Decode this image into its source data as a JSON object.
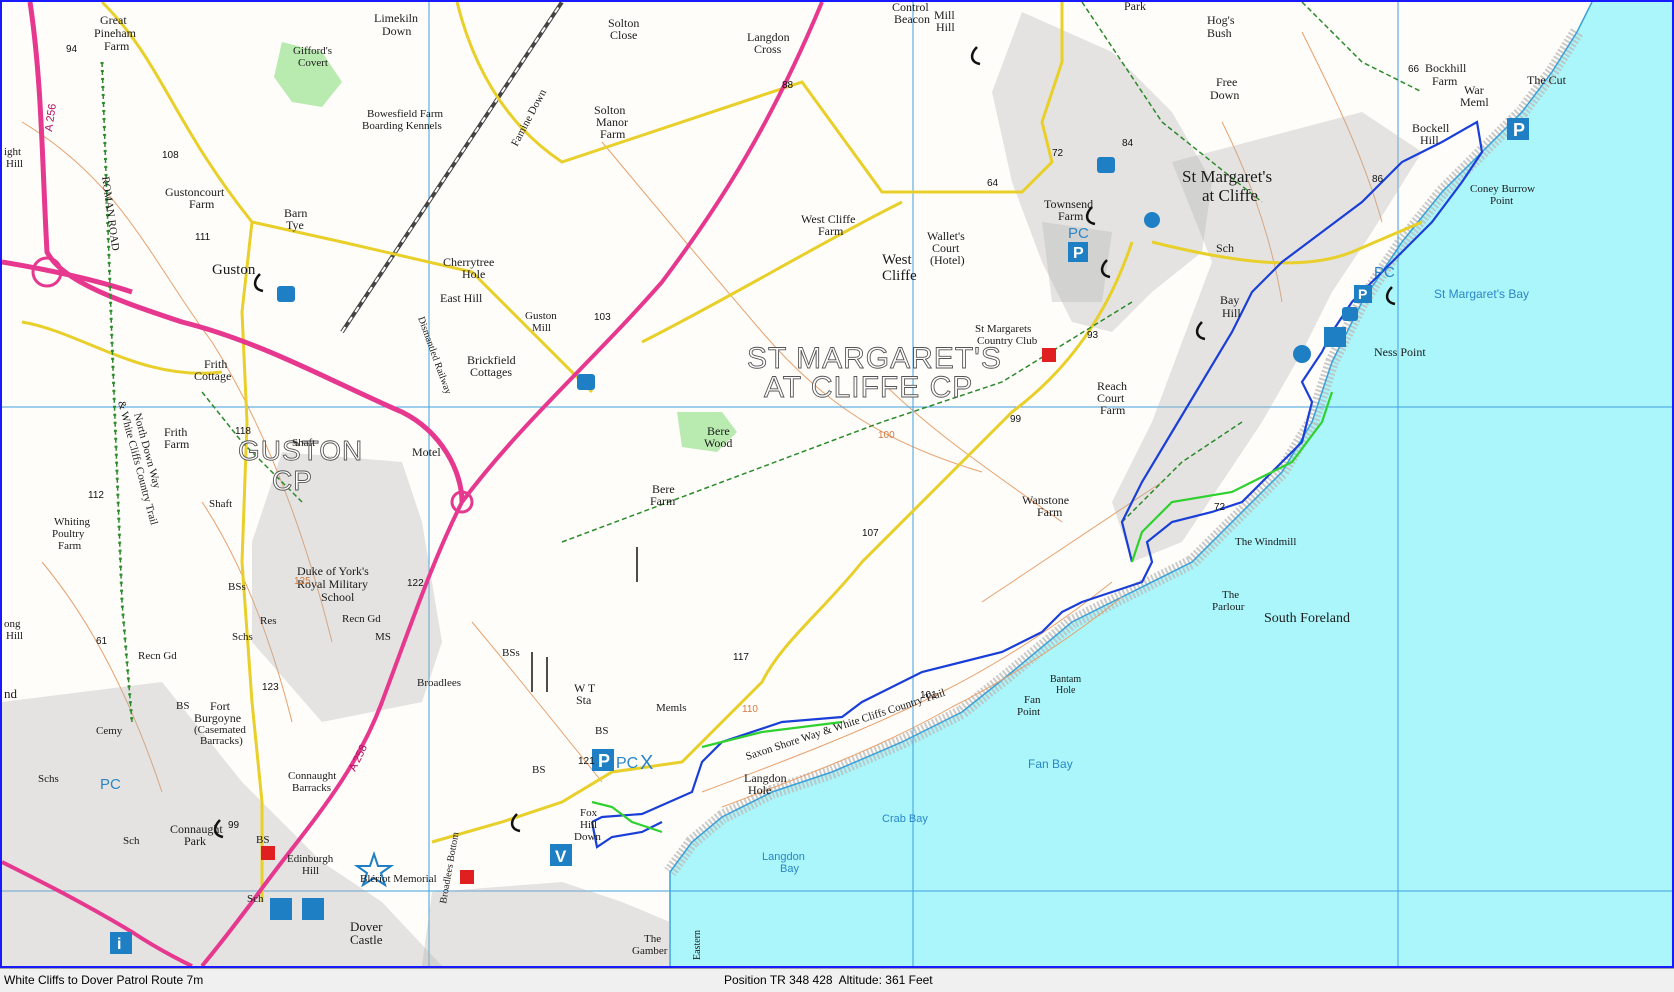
{
  "window": {
    "title": "White Cliffs to Dover Patrol Route 7m"
  },
  "status_bar": {
    "route_name": "White Cliffs to Dover Patrol Route 7m",
    "position_label": "Position",
    "position_value": "TR 348 428",
    "altitude_label": "Altitude:",
    "altitude_value": "361 Feet"
  },
  "map": {
    "colors": {
      "sea": "#aaf6fb",
      "land": "#fffdfa",
      "grid": "#3fa0e0",
      "route": "#1a3fd8",
      "route_green": "#2fd12f",
      "a_road": "#e6388e",
      "b_road": "#e8cf2a",
      "contour": "#e7a06c",
      "footpath": "#2b8a2b",
      "settlement": "#b2b2b2",
      "woodland": "#b9eab0",
      "poi_blue": "#1f7fc4",
      "poi_red": "#e02020"
    },
    "area_labels": {
      "st_margarets_cp_line1": "ST MARGARET'S",
      "st_margarets_cp_line2": "AT CLIFFE CP",
      "guston_cp_line1": "GUSTON",
      "guston_cp_line2": "CP"
    },
    "place_labels": {
      "great_pineham_1": "Great",
      "great_pineham_2": "Pineham",
      "great_pineham_3": "Farm",
      "limekiln_1": "Limekiln",
      "limekiln_2": "Down",
      "giffords_1": "Gifford's",
      "giffords_2": "Covert",
      "solton_close_1": "Solton",
      "solton_close_2": "Close",
      "langdon_cross_1": "Langdon",
      "langdon_cross_2": "Cross",
      "control_1": "Control",
      "control_2": "Beacon",
      "mill_hill_1": "Mill",
      "mill_hill_2": "Hill",
      "park": "Park",
      "hogs_bush_1": "Hog's",
      "hogs_bush_2": "Bush",
      "bockhill_1": "Bockhill",
      "bockhill_2": "Farm",
      "war_meml_1": "War",
      "war_meml_2": "Meml",
      "the_cut": "The Cut",
      "free_down_1": "Free",
      "free_down_2": "Down",
      "bowesfield_1": "Bowesfield Farm",
      "bowesfield_2": "Boarding Kennels",
      "famine_down": "Famine Down",
      "solton_manor_1": "Solton",
      "solton_manor_2": "Manor",
      "solton_manor_3": "Farm",
      "st_margarets_1": "St Margaret's",
      "st_margarets_2": "at Cliffe",
      "bockell_hill_1": "Bockell",
      "bockell_hill_2": "Hill",
      "coney_burrow_1": "Coney Burrow",
      "coney_burrow_2": "Point",
      "gustoncourt_1": "Gustoncourt",
      "gustoncourt_2": "Farm",
      "barn_tye_1": "Barn",
      "barn_tye_2": "Tye",
      "guston": "Guston",
      "west_cliffe_farm_1": "West Cliffe",
      "west_cliffe_farm_2": "Farm",
      "wallets_1": "Wallet's",
      "wallets_2": "Court",
      "wallets_3": "(Hotel)",
      "west_cliffe_1": "West",
      "west_cliffe_2": "Cliffe",
      "townsend_1": "Townsend",
      "townsend_2": "Farm",
      "sch": "Sch",
      "cherrytree_1": "Cherrytree",
      "cherrytree_2": "Hole",
      "east_hill": "East Hill",
      "guston_mill_1": "Guston",
      "guston_mill_2": "Mill",
      "brickfield_1": "Brickfield",
      "brickfield_2": "Cottages",
      "dismantled_railway": "Dismantled Railway",
      "bay_hill_1": "Bay",
      "bay_hill_2": "Hill",
      "st_margarets_bay": "St Margaret's Bay",
      "st_margarets_cc_1": "St Margarets",
      "st_margarets_cc_2": "Country Club",
      "ness_point": "Ness Point",
      "frith_cottage_1": "Frith",
      "frith_cottage_2": "Cottage",
      "reach_court_1": "Reach",
      "reach_court_2": "Court",
      "reach_court_3": "Farm",
      "frith_farm_1": "Frith",
      "frith_farm_2": "Farm",
      "shaft": "Shaft",
      "motel": "Motel",
      "bere_wood_1": "Bere",
      "bere_wood_2": "Wood",
      "bere_farm_1": "Bere",
      "bere_farm_2": "Farm",
      "whiting_1": "Whiting",
      "whiting_2": "Poultry",
      "whiting_3": "Farm",
      "wanstone_1": "Wanstone",
      "wanstone_2": "Farm",
      "the_windmill": "The Windmill",
      "duke_1": "Duke of York's",
      "duke_2": "Royal Military",
      "duke_3": "School",
      "north_downs_way": "North Down Way",
      "white_cliffs_trail": "& White Cliffs Country Trail",
      "the_parlour_1": "The",
      "the_parlour_2": "Parlour",
      "south_foreland": "South Foreland",
      "recn_gd": "Recn Gd",
      "ms": "MS",
      "bss": "BSs",
      "schs": "Schs",
      "res": "Res",
      "wt_sta_1": "W T",
      "wt_sta_2": "Sta",
      "broadlees": "Broadlees",
      "fort_1": "Fort",
      "fort_2": "Burgoyne",
      "fort_3": "(Casemated",
      "fort_4": "Barracks)",
      "bs": "BS",
      "memls": "Memls",
      "bantam_1": "Bantam",
      "bantam_2": "Hole",
      "fan_point_1": "Fan",
      "fan_point_2": "Point",
      "connaught_barracks_1": "Connaught",
      "connaught_barracks_2": "Barracks",
      "saxon_trail": "Saxon Shore Way & White Cliffs Country Trail",
      "fan_bay": "Fan Bay",
      "langdon_hole_1": "Langdon",
      "langdon_hole_2": "Hole",
      "cemy": "Cemy",
      "fox_hill_1": "Fox",
      "fox_hill_2": "Hill",
      "fox_hill_3": "Down",
      "crab_bay": "Crab Bay",
      "connaught_park_1": "Connaught",
      "connaught_park_2": "Park",
      "langdon_bay_1": "Langdon",
      "langdon_bay_2": "Bay",
      "edinburgh_1": "Edinburgh",
      "edinburgh_2": "Hill",
      "bleriot": "Blériot Memorial",
      "broadlees_bottom": "Broadlees Bottom",
      "dover_castle_1": "Dover",
      "dover_castle_2": "Castle",
      "the_gamber_1": "The",
      "the_gamber_2": "Gamber",
      "eastern": "Eastern",
      "roman_road": "ROMAN ROAD",
      "a256": "A 256",
      "a258": "A 258",
      "left_ight_1": "ight",
      "left_ight_2": "Hill",
      "left_ong_1": "ong",
      "left_ong_2": "Hill",
      "left_nd": "nd"
    },
    "spot_heights": {
      "h94": "94",
      "h88": "88",
      "h66": "66",
      "h108": "108",
      "h72a": "72",
      "h84": "84",
      "h86": "86",
      "h111": "111",
      "h64": "64",
      "h103": "103",
      "h93": "93",
      "h99a": "99",
      "h118": "118",
      "h112": "112",
      "h107": "107",
      "h72b": "72",
      "h122": "122",
      "h61": "61",
      "h123": "123",
      "h117": "117",
      "h101": "101",
      "h121": "121",
      "h99b": "99",
      "c100": "100",
      "c110": "110",
      "c125": "125"
    },
    "poi_text": {
      "p": "P",
      "pc": "PC",
      "v": "V",
      "i": "i",
      "x": "X"
    }
  }
}
